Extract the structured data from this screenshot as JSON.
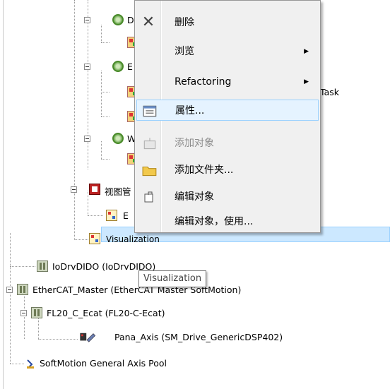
{
  "tree": {
    "task_d": {
      "label": "D"
    },
    "task_e": {
      "label": "E"
    },
    "task_w": {
      "label": "W"
    },
    "task_suffix": "Task",
    "vis_manager": {
      "label": "视图管"
    },
    "vis_child": {
      "label": "E"
    },
    "visualization": {
      "label": "Visualization"
    },
    "iodrv": {
      "label": "IoDrvDIDO (IoDrvDIDO)"
    },
    "ethercat": {
      "label": "EtherCAT_Master (EtherCAT Master SoftMotion)"
    },
    "fl20": {
      "label": "FL20_C_Ecat (FL20-C-Ecat)"
    },
    "pana": {
      "label": "Pana_Axis (SM_Drive_GenericDSP402)"
    },
    "pool": {
      "label": "SoftMotion General Axis Pool"
    }
  },
  "tooltip": {
    "text": "Visualization"
  },
  "context_menu": {
    "items": [
      {
        "label": "删除",
        "icon": "delete-x-icon",
        "enabled": true,
        "submenu": false
      },
      {
        "label": "浏览",
        "icon": "",
        "enabled": true,
        "submenu": true
      },
      {
        "label": "Refactoring",
        "icon": "",
        "enabled": true,
        "submenu": true
      },
      {
        "label": "属性...",
        "icon": "properties-icon",
        "enabled": true,
        "submenu": false,
        "highlighted": true
      },
      {
        "label": "添加对象",
        "icon": "add-object-icon",
        "enabled": false,
        "submenu": false
      },
      {
        "label": "添加文件夹...",
        "icon": "folder-icon",
        "enabled": true,
        "submenu": false
      },
      {
        "label": "编辑对象",
        "icon": "edit-object-icon",
        "enabled": true,
        "submenu": false
      },
      {
        "label": "编辑对象，使用...",
        "icon": "",
        "enabled": true,
        "submenu": false
      }
    ]
  },
  "colors": {
    "selection": "#cce8ff",
    "menu_hover": "#e5f3ff",
    "menu_bg": "#f0f0f0"
  }
}
